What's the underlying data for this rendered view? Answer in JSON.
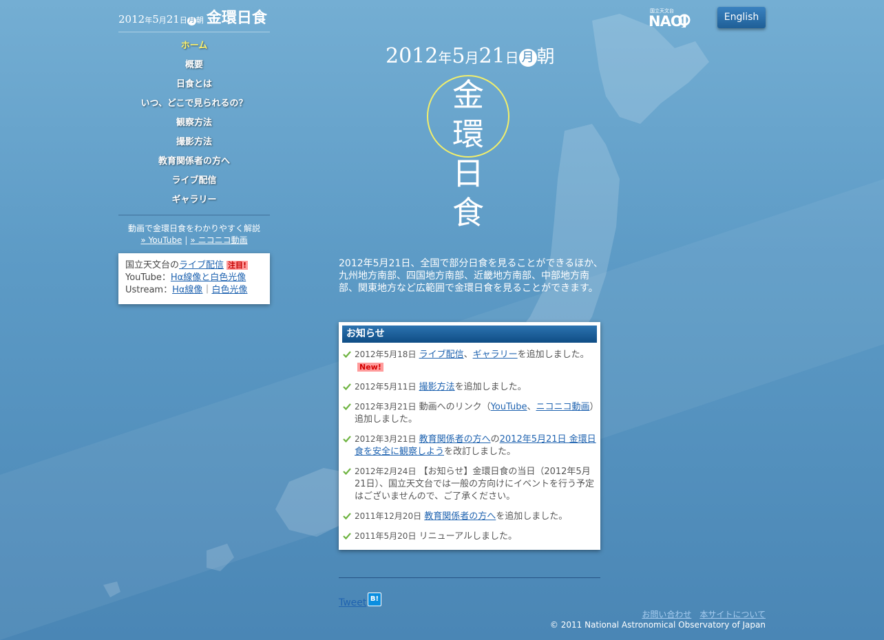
{
  "site": {
    "date_year": "2012",
    "date_year_kanji": "年",
    "date_month": "5",
    "date_month_kanji": "月",
    "date_day": "21",
    "date_day_kanji": "日",
    "weekday": "月",
    "morning": "朝",
    "title": "金環日食"
  },
  "header": {
    "english_label": "English",
    "logo_kanji": "国立天文台",
    "logo_text": "NAOJ"
  },
  "nav": {
    "items": [
      {
        "label": "ホーム",
        "active": true
      },
      {
        "label": "概要"
      },
      {
        "label": "日食とは"
      },
      {
        "label": "いつ、どこで見られるの？"
      },
      {
        "label": "観察方法"
      },
      {
        "label": "撮影方法"
      },
      {
        "label": "教育関係者の方へ"
      },
      {
        "label": "ライブ配信"
      },
      {
        "label": "ギャラリー"
      }
    ]
  },
  "video_note": {
    "text": "動画で金環日食をわかりやすく解説",
    "youtube": "» YouTube",
    "separator": "|",
    "nico": "» ニコニコ動画"
  },
  "live_box": {
    "line1_prefix": "国立天文台の",
    "line1_link": "ライブ配信",
    "line1_badge": "注目!",
    "line2_prefix": "YouTube：",
    "line2_link": "Hα線像と白色光像",
    "line3_prefix": "Ustream：",
    "line3_link1": "Hα線像",
    "line3_sep": "｜",
    "line3_link2": "白色光像"
  },
  "hero": {
    "year": "2012",
    "year_k": "年",
    "month": "5",
    "month_k": "月",
    "day": "21",
    "day_k": "日",
    "weekday": "月",
    "morning": "朝",
    "title_chars": [
      "金",
      "環",
      "日",
      "食"
    ]
  },
  "intro": "2012年5月21日、全国で部分日食を見ることができるほか、九州地方南部、四国地方南部、近畿地方南部、中部地方南部、関東地方など広範囲で金環日食を見ることができます。",
  "news": {
    "heading": "お知らせ",
    "items": [
      {
        "date": "2012年5月18日",
        "link1": "ライブ配信",
        "sep": "、",
        "link2": "ギャラリー",
        "text": "を追加しました。",
        "badge": "New!"
      },
      {
        "date": "2012年5月11日",
        "link1": "撮影方法",
        "text": "を追加しました。"
      },
      {
        "date": "2012年3月21日",
        "pre": "動画へのリンク（",
        "link1": "YouTube",
        "sep": "、",
        "link2": "ニコニコ動画",
        "text": "）追加しました。"
      },
      {
        "date": "2012年3月21日",
        "link1": "教育関係者の方へ",
        "sep": "の",
        "link2": "2012年5月21日 金環日食を安全に観察しよう",
        "text": "を改訂しました。"
      },
      {
        "date": "2012年2月24日",
        "text": "【お知らせ】金環日食の当日（2012年5月21日）、国立天文台では一般の方向けにイベントを行う予定はございませんので、ご了承ください。"
      },
      {
        "date": "2011年12月20日",
        "link1": "教育関係者の方へ",
        "text": "を追加しました。"
      },
      {
        "date": "2011年5月20日",
        "text": "リニューアルしました。"
      }
    ]
  },
  "social": {
    "tweet": "Tweet",
    "hatena": "B!"
  },
  "footer": {
    "contact": "お問い合わせ",
    "about": "本サイトについて",
    "copyright": "© 2011 National Astronomical Observatory of Japan"
  }
}
